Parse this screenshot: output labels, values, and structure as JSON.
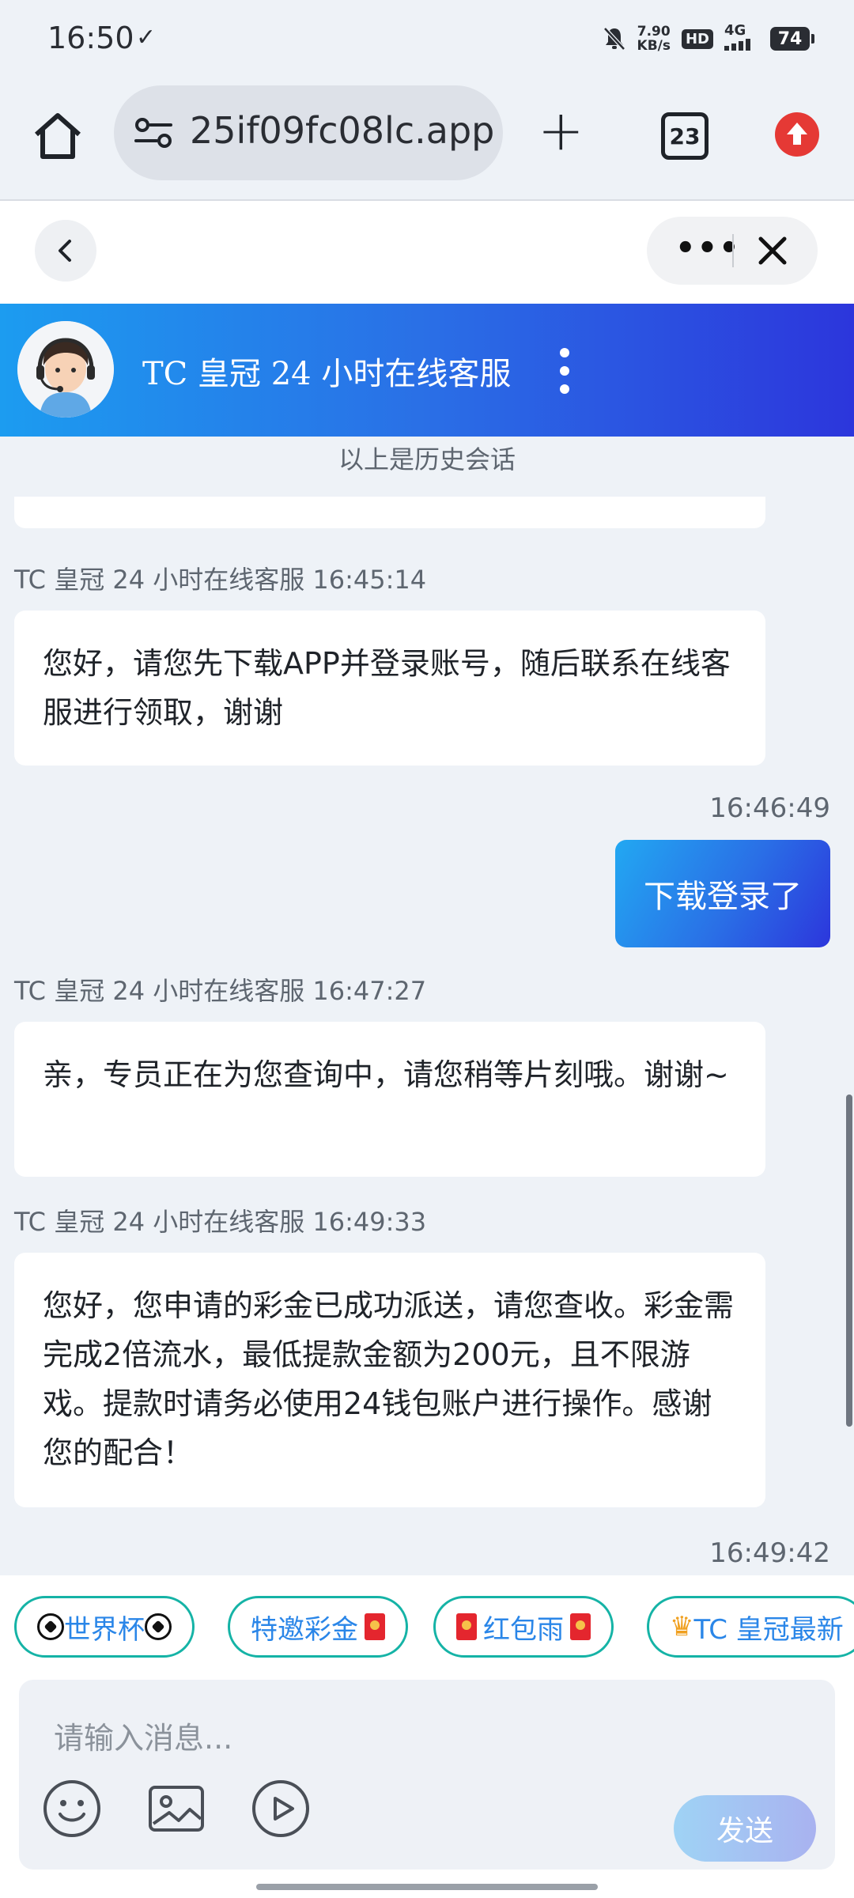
{
  "status_bar": {
    "time": "16:50",
    "check": "✓",
    "speed_value": "7.90",
    "speed_unit": "KB/s",
    "hd": "HD",
    "network": "4G",
    "battery": "74"
  },
  "browser": {
    "url": "25if09fc08lc.app",
    "tab_count": "23"
  },
  "chat": {
    "title": "TC 皇冠 24 小时在线客服",
    "history_note": "以上是历史会话",
    "messages": [
      {
        "sender_line": "TC 皇冠 24 小时在线客服 16:45:14",
        "text": "您好，请您先下载APP并登录账号，随后联系在线客服进行领取，谢谢"
      },
      {
        "time": "16:46:49",
        "text": "下载登录了"
      },
      {
        "sender_line": "TC 皇冠 24 小时在线客服 16:47:27",
        "text": "亲，专员正在为您查询中，请您稍等片刻哦。谢谢~"
      },
      {
        "sender_line": "TC 皇冠 24 小时在线客服 16:49:33",
        "text": "您好，您申请的彩金已成功派送，请您查收。彩金需完成2倍流水，最低提款金额为200元，且不限游戏。提款时请务必使用24钱包账户进行操作。感谢您的配合！"
      },
      {
        "time": "16:49:42"
      }
    ]
  },
  "quick_replies": [
    "世界杯",
    "特邀彩金",
    "红包雨",
    "TC 皇冠最新"
  ],
  "input": {
    "placeholder": "请输入消息...",
    "send_label": "发送"
  },
  "colors": {
    "accent_start": "#1c9cf0",
    "accent_end": "#2c36dc",
    "chip_border": "#15b3a6",
    "chip_text": "#2a86e8"
  }
}
